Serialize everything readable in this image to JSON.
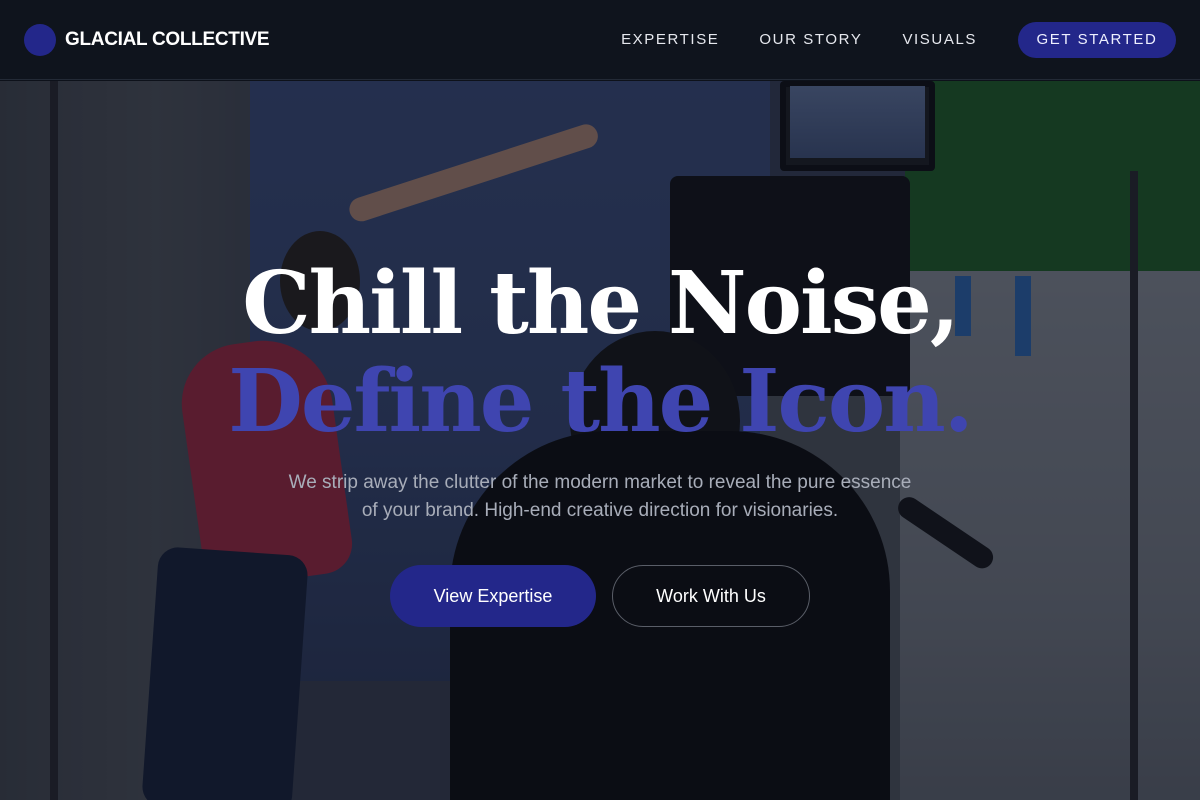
{
  "brand": {
    "name": "GLACIAL COLLECTIVE",
    "color": "#23278a"
  },
  "nav": {
    "links": [
      "EXPERTISE",
      "OUR STORY",
      "VISUALS"
    ],
    "cta_label": "GET STARTED"
  },
  "hero": {
    "headline": "Chill the Noise,",
    "headline_accent": "Define the Icon.",
    "accent_color": "#3f45b0",
    "subtitle": "We strip away the clutter of the modern market to reveal the pure essence of your brand. High-end creative direction for visionaries.",
    "primary_button": "View Expertise",
    "secondary_button": "Work With Us",
    "background_image": "film-set-photo"
  }
}
